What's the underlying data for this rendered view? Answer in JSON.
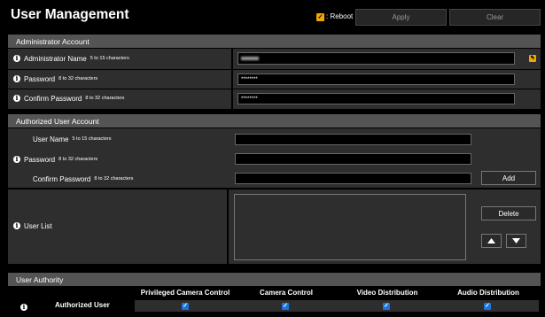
{
  "header": {
    "title": "User Management",
    "reboot_label": ": Reboot",
    "apply_label": "Apply",
    "clear_label": "Clear",
    "reboot_checked": true
  },
  "admin": {
    "section_title": "Administrator Account",
    "name_label": "Administrator Name",
    "name_hint": "5 to 15 characters",
    "name_value": "admin",
    "password_label": "Password",
    "password_hint": "8 to 32 characters",
    "password_value": "********",
    "confirm_label": "Confirm Password",
    "confirm_hint": "8 to 32 characters",
    "confirm_value": "********"
  },
  "authorized": {
    "section_title": "Authorized User Account",
    "username_label": "User Name",
    "username_hint": "5 to 15 characters",
    "password_label": "Password",
    "password_hint": "8 to 32 characters",
    "confirm_label": "Confirm Password",
    "confirm_hint": "8 to 32 characters",
    "add_label": "Add",
    "userlist_label": "User List",
    "delete_label": "Delete",
    "up_icon": "up-triangle-icon",
    "down_icon": "down-triangle-icon"
  },
  "authority": {
    "section_title": "User Authority",
    "row_label": "Authorized User",
    "columns": [
      "Privileged Camera Control",
      "Camera Control",
      "Video Distribution",
      "Audio Distribution"
    ],
    "checked": [
      true,
      true,
      true,
      true
    ]
  },
  "colors": {
    "accent_checkbox": "#1b75d8",
    "reboot_checkbox": "#f0a500",
    "section_header": "#545454",
    "row_background": "#2e2e2e"
  }
}
